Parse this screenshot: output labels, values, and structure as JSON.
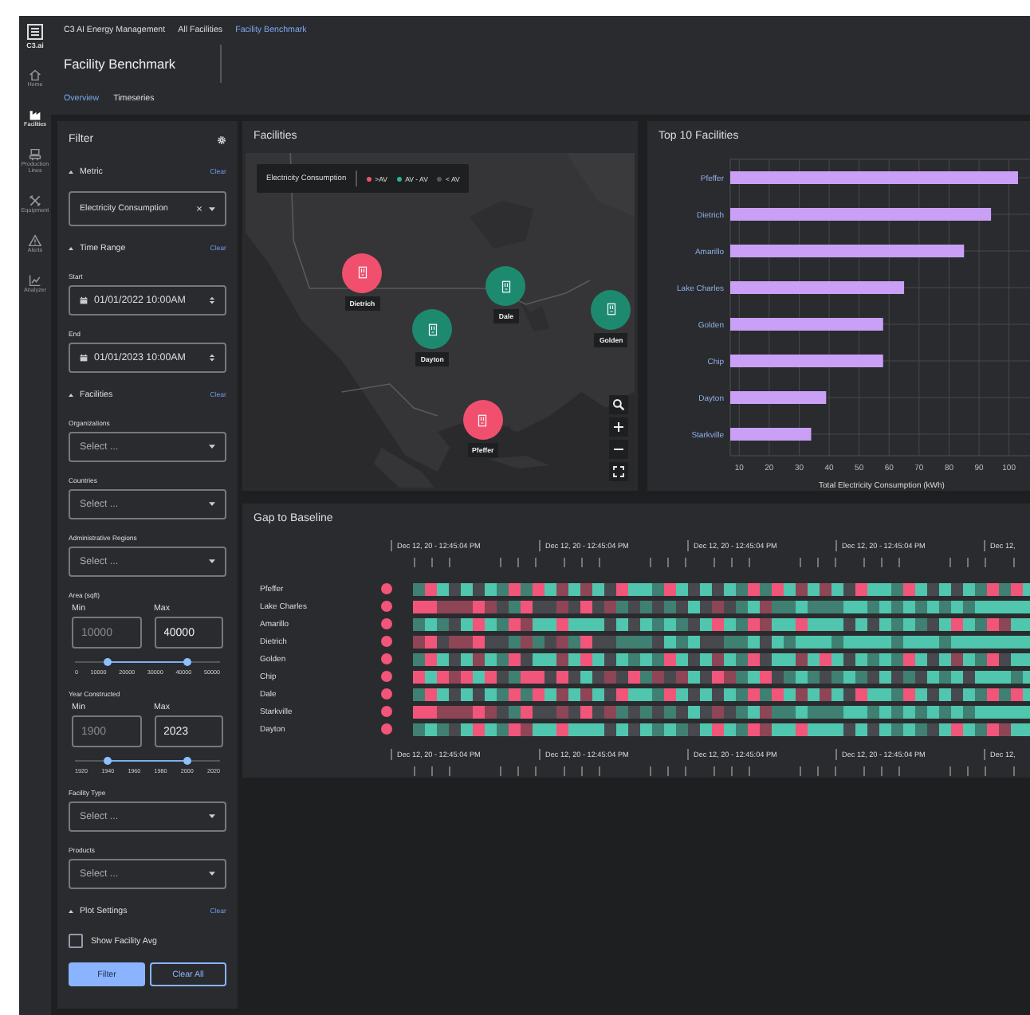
{
  "app_rail": {
    "logo": "C3.ai",
    "items": [
      {
        "label": "Home",
        "selected": false
      },
      {
        "label": "Facilities",
        "selected": true
      },
      {
        "label": "Production Lines",
        "selected": false
      },
      {
        "label": "Equipment",
        "selected": false
      },
      {
        "label": "Alerts",
        "selected": false
      },
      {
        "label": "Analyzer",
        "selected": false
      }
    ]
  },
  "breadcrumbs": [
    {
      "label": "C3 AI Energy Management",
      "selected": false
    },
    {
      "label": "All Facilities",
      "selected": false
    },
    {
      "label": "Facility Benchmark",
      "selected": true
    }
  ],
  "page_title": "Facility Benchmark",
  "tabs": [
    {
      "label": "Overview",
      "selected": true
    },
    {
      "label": "Timeseries",
      "selected": false
    }
  ],
  "filter": {
    "title": "Filter",
    "sections": [
      {
        "title": "Metric",
        "clear": "Clear",
        "fields": [
          {
            "kind": "select",
            "value": "Electricity Consumption",
            "clearable": true
          }
        ]
      },
      {
        "title": "Time Range",
        "clear": "Clear",
        "fields": [
          {
            "kind": "date",
            "label": "Start",
            "value": "01/01/2022 10:00AM"
          },
          {
            "kind": "date",
            "label": "End",
            "value": "01/01/2023 10:00AM"
          }
        ]
      },
      {
        "title": "Facilities",
        "clear": "Clear",
        "fields": [
          {
            "kind": "select",
            "label": "Organizations",
            "placeholder": "Select ..."
          },
          {
            "kind": "select",
            "label": "Countries",
            "placeholder": "Select ..."
          },
          {
            "kind": "select",
            "label": "Administrative Regions",
            "placeholder": "Select ..."
          },
          {
            "kind": "range",
            "label": "Area (sqft)",
            "min_label": "Min",
            "max_label": "Max",
            "min_placeholder": "10000",
            "max_value": "40000",
            "thumbs": [
              {
                "level": 0.22
              },
              {
                "level": 0.78
              }
            ],
            "ticks": [
              "0",
              "10000",
              "20000",
              "30000",
              "40000",
              "50000"
            ]
          },
          {
            "kind": "range",
            "label": "Year Constructed",
            "min_label": "Min",
            "max_label": "Max",
            "min_placeholder": "1900",
            "max_value": "2023",
            "thumbs": [
              {
                "level": 0.22
              },
              {
                "level": 0.78
              }
            ],
            "ticks": [
              "1920",
              "1940",
              "1960",
              "1980",
              "2000",
              "2020"
            ]
          },
          {
            "kind": "select",
            "label": "Facility Type",
            "placeholder": "Select ..."
          },
          {
            "kind": "select",
            "label": "Products",
            "placeholder": "Select ..."
          }
        ]
      },
      {
        "title": "Plot Settings",
        "clear": "Clear",
        "fields": [
          {
            "kind": "checkbox",
            "label": "Show Facility Avg",
            "checked": false
          }
        ]
      }
    ],
    "buttons": [
      {
        "label": "Filter",
        "kind": "primary"
      },
      {
        "label": "Clear All",
        "kind": "secondary"
      }
    ]
  },
  "map": {
    "title": "Facilities",
    "legend": {
      "title": "Electricity Consumption",
      "items": [
        {
          "label": ">AV",
          "color": "#f0506e"
        },
        {
          "label": "AV - AV",
          "color": "#2bb39a"
        },
        {
          "label": "< AV",
          "color": "#55575c"
        }
      ]
    },
    "markers": [
      {
        "label": "Dietrich",
        "color": "#f0506e"
      },
      {
        "label": "Dale",
        "color": "#1d8a70"
      },
      {
        "label": "Dayton",
        "color": "#1d8a70"
      },
      {
        "label": "Golden",
        "color": "#1d8a70"
      },
      {
        "label": "Pfeffer",
        "color": "#f0506e"
      }
    ]
  },
  "top_facilities": {
    "title": "Top 10 Facilities",
    "chart_data": {
      "type": "bar",
      "orientation": "horizontal",
      "xlabel": "Total Electricity Consumption (kWh)",
      "categories": [
        "Pfeffer",
        "Dietrich",
        "Amarillo",
        "Lake Charles",
        "Golden",
        "Chip",
        "Dayton",
        "Starkville"
      ],
      "values": [
        103,
        94,
        85,
        65,
        58,
        58,
        39,
        34
      ],
      "xlim": [
        7,
        107
      ],
      "grid": true,
      "xticks": [
        10,
        20,
        30,
        40,
        50,
        60,
        70,
        80,
        90,
        100
      ]
    }
  },
  "gap_to_baseline": {
    "title": "Gap to Baseline",
    "time_labels_top": [
      "Dec 12, 20 - 12:45:04 PM",
      "Dec 12, 20 - 12:45:04 PM",
      "Dec 12, 20 - 12:45:04 PM",
      "Dec 12, 20 - 12:45:04 PM",
      "Dec 12,"
    ],
    "time_labels_bottom": [
      "Dec 12, 20 - 12:45:04 PM",
      "Dec 12, 20 - 12:45:04 PM",
      "Dec 12, 20 - 12:45:04 PM",
      "Dec 12, 20 - 12:45:04 PM",
      "Dec 12,"
    ],
    "rows": [
      {
        "label": "Pfeffer",
        "color": "#f2557a"
      },
      {
        "label": "Lake Charles",
        "color": "#f2557a"
      },
      {
        "label": "Amarillo",
        "color": "#f2557a"
      },
      {
        "label": "Dietrich",
        "color": "#f2557a"
      },
      {
        "label": "Golden",
        "color": "#f2557a"
      },
      {
        "label": "Chip",
        "color": "#f2557a"
      },
      {
        "label": "Dale",
        "color": "#f2557a"
      },
      {
        "label": "Starkville",
        "color": "#f2557a"
      },
      {
        "label": "Dayton",
        "color": "#f2557a"
      }
    ]
  }
}
